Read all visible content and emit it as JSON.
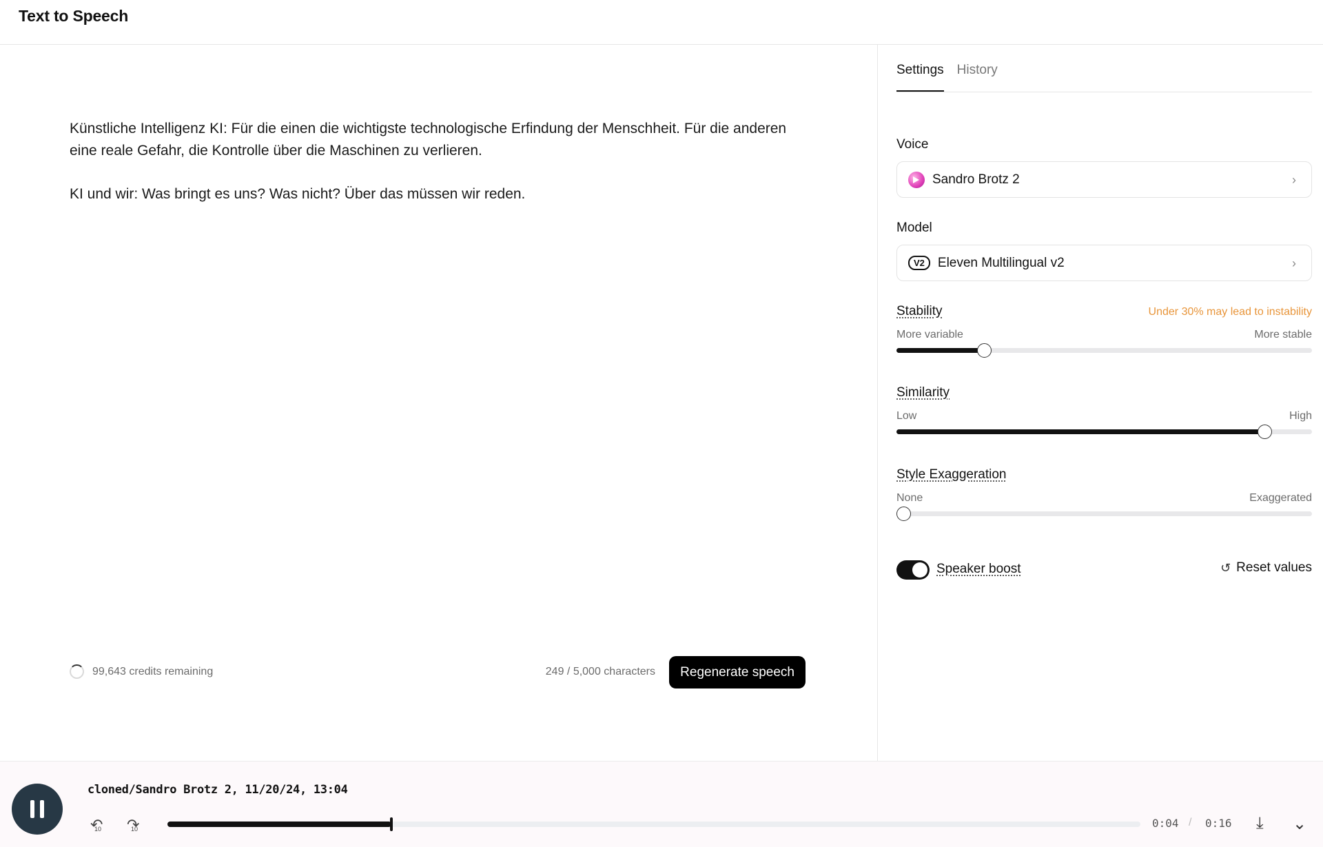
{
  "header": {
    "title": "Text to Speech"
  },
  "editor": {
    "paragraphs": [
      "Künstliche Intelligenz KI: Für die einen die wichtigste technologische Erfindung der Menschheit. Für die anderen eine reale Gefahr, die Kontrolle über die Maschinen zu verlieren.",
      "KI und wir: Was bringt es uns? Was nicht? Über das müssen wir reden."
    ],
    "credits": "99,643 credits remaining",
    "char_count": "249 / 5,000 characters",
    "regenerate_label": "Regenerate speech"
  },
  "panel": {
    "tabs": [
      {
        "label": "Settings",
        "active": true
      },
      {
        "label": "History",
        "active": false
      }
    ],
    "voice": {
      "label": "Voice",
      "value": "Sandro Brotz 2"
    },
    "model": {
      "label": "Model",
      "badge": "V2",
      "value": "Eleven Multilingual v2"
    },
    "sliders": {
      "stability": {
        "title": "Stability",
        "warning": "Under 30% may lead to instability",
        "min_label": "More variable",
        "max_label": "More stable",
        "value": 0.21
      },
      "similarity": {
        "title": "Similarity",
        "min_label": "Low",
        "max_label": "High",
        "value": 0.885
      },
      "style": {
        "title": "Style Exaggeration",
        "min_label": "None",
        "max_label": "Exaggerated",
        "value": 0.0
      }
    },
    "speaker_boost": {
      "label": "Speaker boost",
      "enabled": true
    },
    "reset_label": "Reset values"
  },
  "player": {
    "title": "cloned/Sandro Brotz 2, 11/20/24, 13:04",
    "current_time": "0:04",
    "separator": "/",
    "total_time": "0:16",
    "progress": 0.23
  },
  "colors": {
    "accent": "#111111",
    "warning": "#e8953a",
    "player_button": "#273845"
  }
}
